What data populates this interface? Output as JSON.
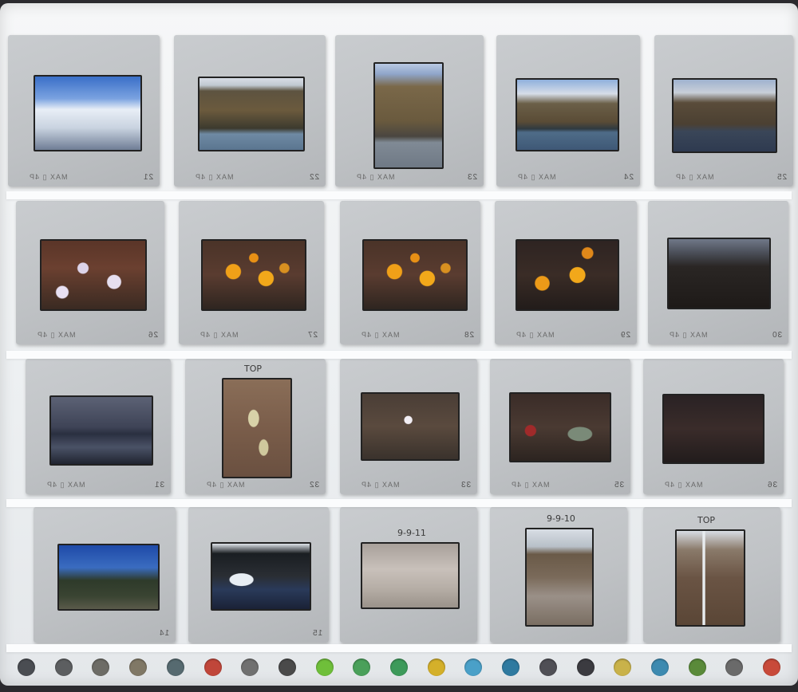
{
  "tray": {
    "rows": [
      {
        "slides": [
          {
            "number": "21",
            "brand": "MAX ▯ 4P",
            "note": "",
            "scene": "sky-clouds-tree"
          },
          {
            "number": "22",
            "brand": "MAX ▯ 4P",
            "note": "",
            "scene": "hill-lake"
          },
          {
            "number": "23",
            "brand": "MAX ▯ 4P",
            "note": "",
            "scene": "hill-lake-portrait"
          },
          {
            "number": "24",
            "brand": "MAX ▯ 4P",
            "note": "",
            "scene": "hill-lake-trees"
          },
          {
            "number": "25",
            "brand": "MAX ▯ 4P",
            "note": "",
            "scene": "hill-lake-dusk"
          }
        ]
      },
      {
        "slides": [
          {
            "number": "26",
            "brand": "MAX ▯ 4P",
            "note": "",
            "scene": "white-flowers"
          },
          {
            "number": "27",
            "brand": "MAX ▯ 4P",
            "note": "",
            "scene": "sunflowers"
          },
          {
            "number": "28",
            "brand": "MAX ▯ 4P",
            "note": "",
            "scene": "sunflowers"
          },
          {
            "number": "29",
            "brand": "MAX ▯ 4P",
            "note": "",
            "scene": "sunflowers-dark"
          },
          {
            "number": "30",
            "brand": "MAX ▯ 4P",
            "note": "",
            "scene": "dark-landscape"
          }
        ]
      },
      {
        "slides": [
          {
            "number": "31",
            "brand": "MAX ▯ 4P",
            "note": "",
            "scene": "dark-lake"
          },
          {
            "number": "32",
            "brand": "MAX ▯ 4P",
            "note": "TOP",
            "scene": "plant-portrait"
          },
          {
            "number": "33",
            "brand": "MAX ▯ 4P",
            "note": "",
            "scene": "grass-white-flower"
          },
          {
            "number": "35",
            "brand": "MAX ▯ 4P",
            "note": "",
            "scene": "red-plant"
          },
          {
            "number": "36",
            "brand": "MAX ▯ 4P",
            "note": "",
            "scene": "dark-twigs"
          }
        ]
      },
      {
        "slides": [
          {
            "number": "14",
            "brand": "",
            "note": "",
            "scene": "blue-sky-forest"
          },
          {
            "number": "15",
            "brand": "",
            "note": "",
            "scene": "river-snow"
          },
          {
            "number": "",
            "brand": "",
            "note": "9-9-11",
            "scene": "gravel"
          },
          {
            "number": "",
            "brand": "",
            "note": "9-9-10",
            "scene": "snow-field-portrait"
          },
          {
            "number": "",
            "brand": "",
            "note": "TOP",
            "scene": "waterfall-portrait"
          }
        ]
      }
    ]
  },
  "colors": {
    "tray": "#eef0f2",
    "mount": "#c4c7ca",
    "background": "#2b2a2e"
  },
  "bottom_strip": {
    "dot_colors": [
      "#4a4d52",
      "#5c5e60",
      "#6d6c66",
      "#807866",
      "#566a70",
      "#c0463a",
      "#707070",
      "#4a4a4a",
      "#6fbf3a",
      "#4aa05a",
      "#3d9a5a",
      "#d4b02a",
      "#4aa0c8",
      "#2f7aa0",
      "#4f4f55",
      "#3b3b40",
      "#c9b24a",
      "#3d8ab0",
      "#5a8a3a",
      "#6a6a6a",
      "#c84a3a"
    ]
  }
}
